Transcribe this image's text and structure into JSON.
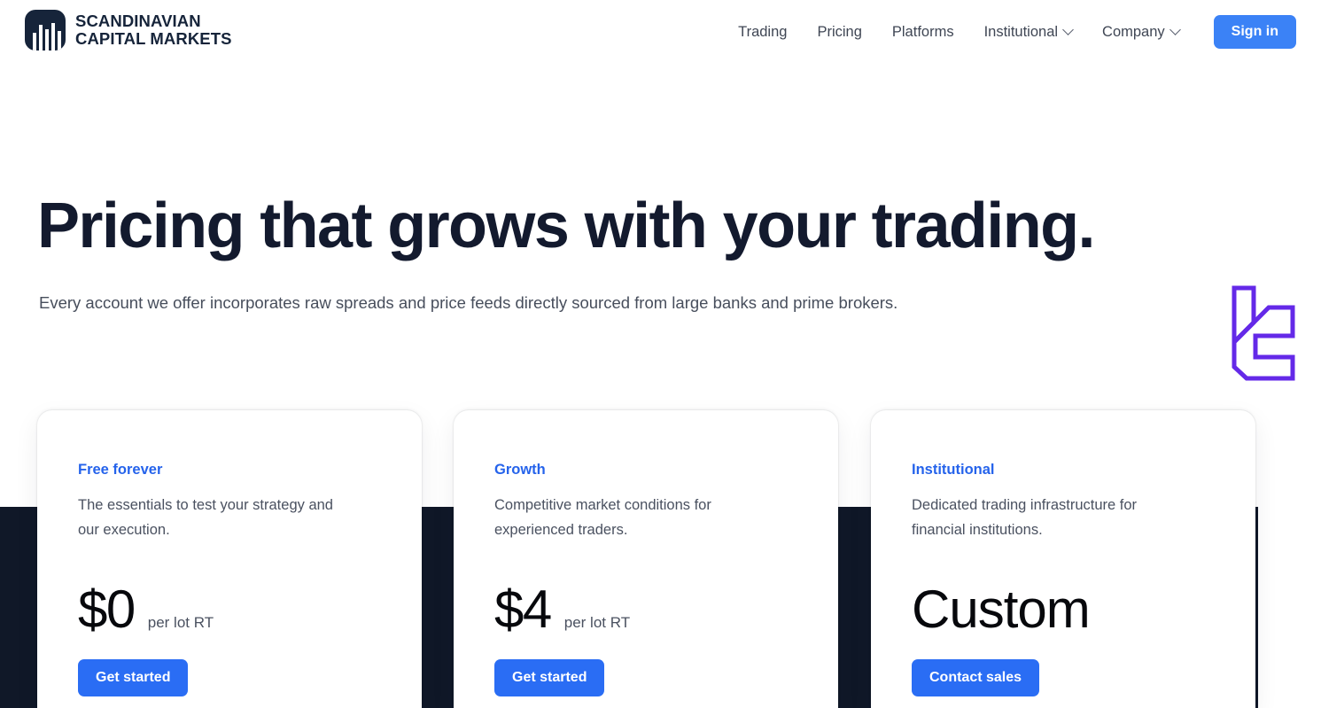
{
  "brand": {
    "line1": "SCANDINAVIAN",
    "line2": "CAPITAL MARKETS",
    "mark_icon": "bar-chart-mark-icon",
    "mark_color": "#16243a"
  },
  "nav": {
    "items": [
      {
        "label": "Trading",
        "has_dropdown": false
      },
      {
        "label": "Pricing",
        "has_dropdown": false
      },
      {
        "label": "Platforms",
        "has_dropdown": false
      },
      {
        "label": "Institutional",
        "has_dropdown": true
      },
      {
        "label": "Company",
        "has_dropdown": true
      }
    ],
    "signin_label": "Sign in",
    "signin_color": "#3b82f6"
  },
  "hero": {
    "title": "Pricing that grows with your trading.",
    "subtitle": "Every account we offer incorporates raw spreads and price feeds directly sourced from large banks and prime brokers.",
    "decoration_icon": "purple-monogram-icon",
    "decoration_color": "#6429e8"
  },
  "band": {
    "color": "#101828"
  },
  "pricing": {
    "accent_color": "#2563eb",
    "cta_color": "#2a6df4",
    "cards": [
      {
        "name": "Free forever",
        "description": "The essentials to test your strategy and our execution.",
        "price": "$0",
        "unit": "per lot RT",
        "cta": "Get started"
      },
      {
        "name": "Growth",
        "description": "Competitive market conditions for experienced traders.",
        "price": "$4",
        "unit": "per lot RT",
        "cta": "Get started"
      },
      {
        "name": "Institutional",
        "description": "Dedicated trading infrastructure for financial institutions.",
        "price": "Custom",
        "unit": "",
        "cta": "Contact sales"
      }
    ]
  }
}
